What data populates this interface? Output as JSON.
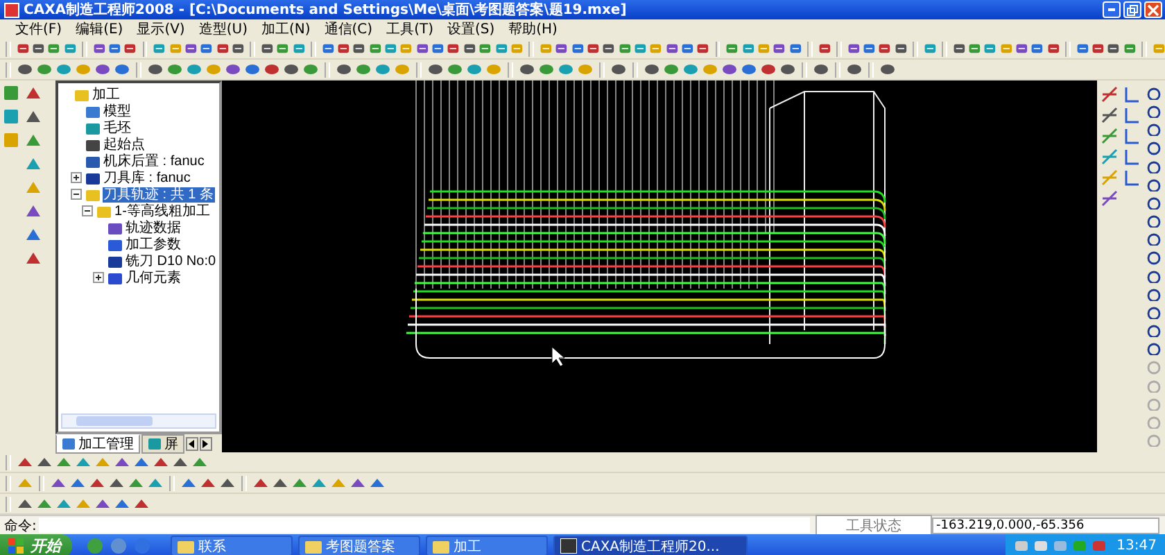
{
  "window": {
    "title": "CAXA制造工程师2008  - [C:\\Documents and Settings\\Me\\桌面\\考图题答案\\题19.mxe]"
  },
  "menu": [
    "文件(F)",
    "编辑(E)",
    "显示(V)",
    "造型(U)",
    "加工(N)",
    "通信(C)",
    "工具(T)",
    "设置(S)",
    "帮助(H)"
  ],
  "tree": [
    {
      "label": "加工",
      "kind": "folder",
      "selected": false,
      "children": [
        {
          "label": "模型",
          "kind": "model",
          "selected": false
        },
        {
          "label": "毛坯",
          "kind": "stock",
          "selected": false
        },
        {
          "label": "起始点",
          "kind": "point",
          "selected": false
        },
        {
          "label": "机床后置 : fanuc",
          "kind": "machine",
          "selected": false
        },
        {
          "label": "刀具库 : fanuc",
          "kind": "tool",
          "selected": false,
          "expanded": false
        },
        {
          "label": "刀具轨迹 : 共 1 条",
          "kind": "folder",
          "selected": true,
          "expanded": true,
          "children": [
            {
              "label": "1-等高线粗加工",
              "kind": "folder",
              "selected": false,
              "expanded": true,
              "children": [
                {
                  "label": "轨迹数据",
                  "kind": "data",
                  "selected": false
                },
                {
                  "label": "加工参数",
                  "kind": "params",
                  "selected": false
                },
                {
                  "label": "铣刀 D10 No:0",
                  "kind": "tool",
                  "selected": false
                },
                {
                  "label": "几何元素",
                  "kind": "geometry",
                  "selected": false,
                  "expanded": false
                }
              ]
            }
          ]
        }
      ]
    }
  ],
  "panel_tabs": [
    {
      "label": "加工管理",
      "selected": true
    },
    {
      "label": "屏",
      "selected": false
    }
  ],
  "command": {
    "label": "命令:"
  },
  "status_bar": {
    "state": "工具状态",
    "coordinates": "-163.219,0.000,-65.356"
  },
  "taskbar": {
    "start": "开始",
    "items": [
      {
        "label": "联系",
        "kind": "folder",
        "selected": false
      },
      {
        "label": "考图题答案",
        "kind": "folder",
        "selected": false
      },
      {
        "label": "加工",
        "kind": "folder",
        "selected": false
      },
      {
        "label": "CAXA制造工程师20...",
        "kind": "app",
        "selected": true
      }
    ],
    "clock": "13:47"
  }
}
